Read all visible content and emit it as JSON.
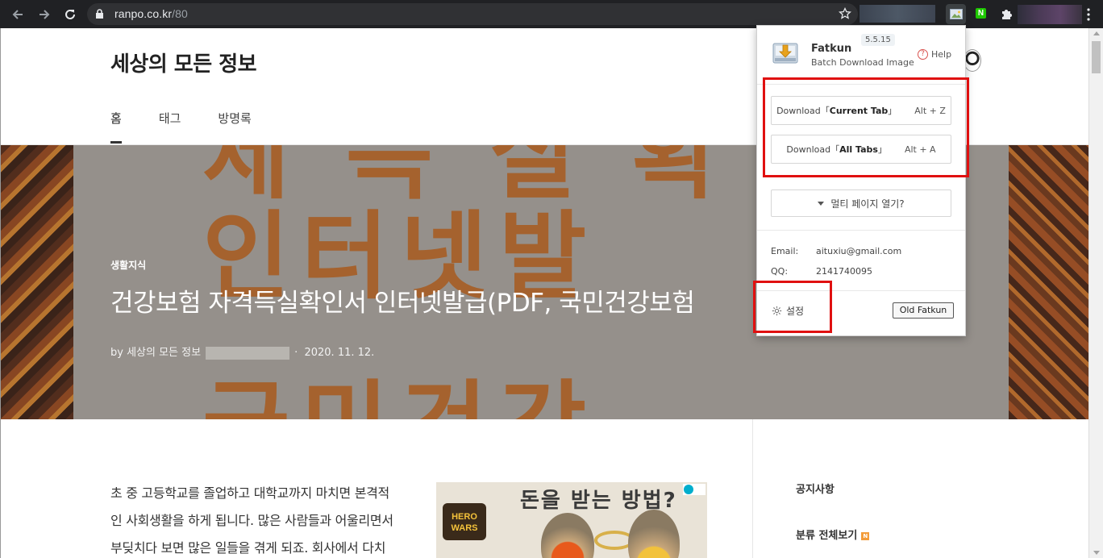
{
  "browser": {
    "url_host": "ranpo.co.kr",
    "url_path": "/80"
  },
  "site": {
    "title": "세상의 모든 정보",
    "nav": [
      "홈",
      "태그",
      "방명록"
    ]
  },
  "post": {
    "category": "생활지식",
    "headline": "건강보험 자격득실확인서 인터넷발급(PDF, 국민건강보험",
    "author": "by 세상의 모든 정보",
    "date": "2020. 11. 12.",
    "hero_text": [
      "인터넷발",
      "국민건강"
    ],
    "body_lines": [
      "초 중 고등학교를 졸업하고 대학교까지 마치면 본격적",
      "인 사회생활을 하게 됩니다. 많은 사람들과 어울리면서",
      "부딪치다 보면 많은 일들을 겪게 되죠. 회사에서 다치"
    ]
  },
  "ad": {
    "title": "돈을 받는 방법?",
    "logo_line1": "HERO",
    "logo_line2": "WARS"
  },
  "sidebar": {
    "notice": "공지사항",
    "all_categories": "분류 전체보기",
    "badge": "N"
  },
  "popup": {
    "name": "Fatkun",
    "version": "5.5.15",
    "subtitle": "Batch Download Image",
    "help": "Help",
    "btn_current_prefix": "Download「",
    "btn_current_bold": "Current Tab",
    "btn_current_suffix": "」",
    "btn_current_shortcut": "Alt + Z",
    "btn_all_prefix": "Download「",
    "btn_all_bold": "All Tabs",
    "btn_all_suffix": "」",
    "btn_all_shortcut": "Alt + A",
    "multi_page": "멀티 페이지 열기?",
    "email_label": "Email:",
    "email_value": "aituxiu@gmail.com",
    "qq_label": "QQ:",
    "qq_value": "2141740095",
    "settings": "설정",
    "old_button": "Old Fatkun"
  },
  "extensions": {
    "naver_letter": "N"
  },
  "colors": {
    "chrome_bg": "#202124",
    "annotation_red": "#e01010",
    "hero_text": "#c8702c"
  }
}
